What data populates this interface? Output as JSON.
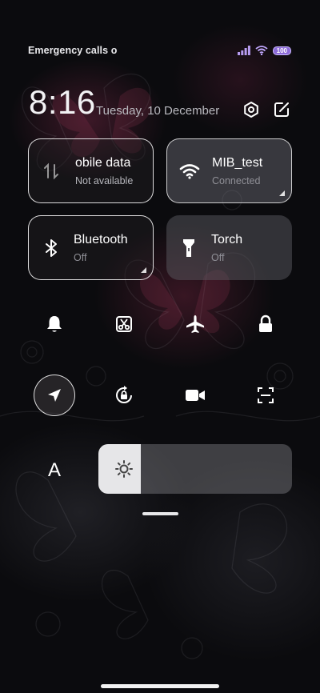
{
  "status_bar": {
    "carrier": "Emergency calls o",
    "battery": "100"
  },
  "header": {
    "time": "8:16",
    "date": "Tuesday, 10 December"
  },
  "tiles": [
    {
      "label": "obile data",
      "sub": "Not available"
    },
    {
      "label": "MIB_test",
      "sub": "Connected"
    },
    {
      "label": "Bluetooth",
      "sub": "Off"
    },
    {
      "label": "Torch",
      "sub": "Off"
    }
  ],
  "font_button": "A",
  "brightness": {
    "level": 0.22
  },
  "icons": {
    "settings": "gear-icon",
    "edit": "edit-icon",
    "mobile_data": "mobile-data-icon",
    "wifi": "wifi-icon",
    "bluetooth": "bluetooth-icon",
    "torch": "torch-icon",
    "toggles": [
      "bell-icon",
      "screenshot-icon",
      "airplane-icon",
      "lock-icon",
      "location-icon",
      "rotation-lock-icon",
      "video-icon",
      "scan-icon"
    ]
  }
}
